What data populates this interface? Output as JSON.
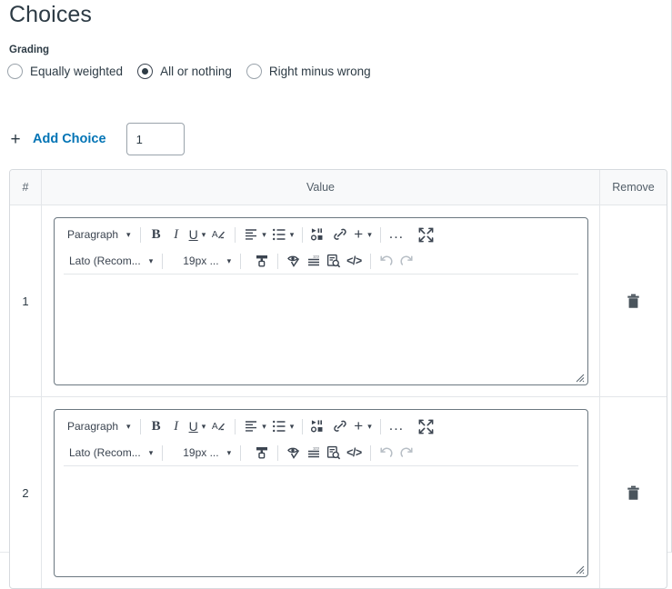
{
  "page": {
    "title": "Choices",
    "accent_color": "#0374b5",
    "text_color": "#2d3b45",
    "border_color": "#d6dade",
    "header_bg": "#f8f9fa"
  },
  "grading": {
    "label": "Grading",
    "options": [
      {
        "label": "Equally weighted",
        "selected": false
      },
      {
        "label": "All or nothing",
        "selected": true
      },
      {
        "label": "Right minus wrong",
        "selected": false
      }
    ]
  },
  "add_choice": {
    "plus": "+",
    "link_label": "Add Choice",
    "count_value": "1",
    "count_placeholder": ""
  },
  "table": {
    "headers": {
      "number": "#",
      "value": "Value",
      "remove": "Remove"
    },
    "rows": [
      {
        "number": "1",
        "editor_content": "",
        "remove_title": "Remove"
      },
      {
        "number": "2",
        "editor_content": "",
        "remove_title": "Remove"
      }
    ]
  },
  "editor_toolbar": {
    "row1": {
      "block_format": "Paragraph",
      "bold": "B",
      "italic": "I",
      "underline": "U",
      "text_color": "A",
      "align": "align-left",
      "list": "bulleted-list",
      "media": "media",
      "link": "link",
      "insert": "+",
      "more": "...",
      "fullscreen": "fullscreen"
    },
    "row2": {
      "font_family": "Lato (Recom...",
      "font_size": "19px ...",
      "format_painter": "format-painter",
      "accessibility": "accessibility-checker",
      "word_count": "word-count",
      "find_replace": "find-and-replace",
      "html_code": "</>",
      "undo": "undo",
      "redo": "redo"
    }
  }
}
